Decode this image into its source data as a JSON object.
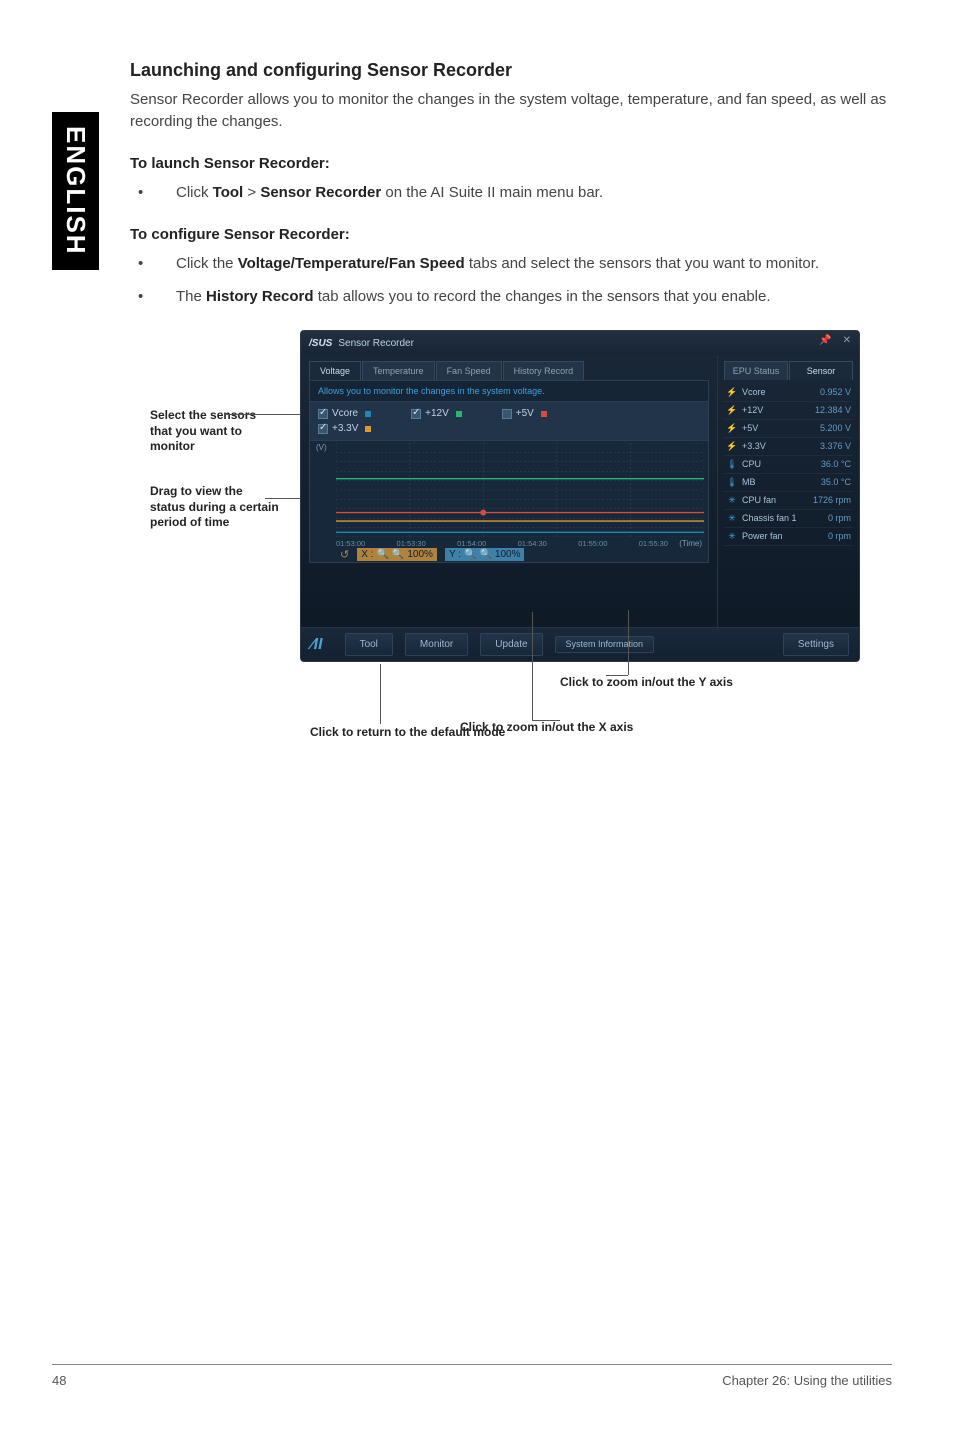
{
  "sidebar_label": "ENGLISH",
  "section_title": "Launching and configuring Sensor Recorder",
  "intro": "Sensor Recorder allows you to monitor the changes in the system voltage, temperature, and fan speed, as well as recording the changes.",
  "launch_head": "To launch Sensor Recorder:",
  "launch_item_pre": "Click ",
  "launch_tool": "Tool",
  "launch_gt": " > ",
  "launch_sr": "Sensor Recorder",
  "launch_item_post": " on the AI Suite II main menu bar.",
  "config_head": "To configure Sensor Recorder:",
  "config_item1_pre": "Click the ",
  "config_item1_bold": "Voltage/Temperature/Fan Speed",
  "config_item1_post": " tabs and select the sensors that you want to monitor.",
  "config_item2_pre": "The ",
  "config_item2_bold": "History Record",
  "config_item2_post": " tab allows you to record the changes in the sensors that you enable.",
  "annotations": {
    "select_sensors": "Select the sensors that you want to monitor",
    "drag_view": "Drag to view the status during a certain period of time",
    "zoom_y": "Click to zoom in/out the Y axis",
    "zoom_x": "Click to zoom in/out the X axis",
    "reset": "Click to return to the default mode"
  },
  "app": {
    "brand": "/SUS",
    "title": "Sensor Recorder",
    "win_pin": "📌",
    "win_close": "✕",
    "tabs": {
      "voltage": "Voltage",
      "temperature": "Temperature",
      "fan": "Fan Speed",
      "history": "History Record"
    },
    "desc": "Allows you to monitor the changes in the system voltage.",
    "checks": {
      "vcore": "Vcore",
      "p12v": "+12V",
      "p5v": "+5V",
      "p33v": "+3.3V"
    },
    "y_unit": "(V)",
    "time_label": "(Time)",
    "status_tabs": {
      "epu": "EPU Status",
      "sensor": "Sensor"
    },
    "sensors": [
      {
        "icon": "⚡",
        "name": "Vcore",
        "value": "0.952 V"
      },
      {
        "icon": "⚡",
        "name": "+12V",
        "value": "12.384 V"
      },
      {
        "icon": "⚡",
        "name": "+5V",
        "value": "5.200 V"
      },
      {
        "icon": "⚡",
        "name": "+3.3V",
        "value": "3.376 V"
      },
      {
        "icon": "🌡",
        "name": "CPU",
        "value": "36.0 °C"
      },
      {
        "icon": "🌡",
        "name": "MB",
        "value": "35.0 °C"
      },
      {
        "icon": "✳",
        "name": "CPU fan",
        "value": "1726 rpm"
      },
      {
        "icon": "✳",
        "name": "Chassis fan 1",
        "value": "0 rpm"
      },
      {
        "icon": "✳",
        "name": "Power fan",
        "value": "0 rpm"
      }
    ],
    "zoom": {
      "x_label": "X :",
      "y_label": "Y :",
      "x_pct": "100%",
      "y_pct": "100%"
    },
    "bottom": {
      "tool": "Tool",
      "monitor": "Monitor",
      "update": "Update",
      "sysinfo": "System Information",
      "settings": "Settings"
    }
  },
  "chart_data": {
    "type": "line",
    "xlabel": "(Time)",
    "ylabel": "(V)",
    "ylim": [
      0,
      20
    ],
    "y_ticks": [
      0,
      2,
      4,
      6,
      8,
      10,
      12,
      14,
      16,
      18,
      20
    ],
    "x_ticks": [
      "01:53:00",
      "01:53:30",
      "01:54:00",
      "01:54:30",
      "01:55:00",
      "01:55:30"
    ],
    "series": [
      {
        "name": "Vcore",
        "color": "#1f88b6",
        "values": [
          1.0,
          1.0,
          1.0,
          1.0,
          1.0,
          1.0
        ]
      },
      {
        "name": "+12V",
        "color": "#2bb673",
        "values": [
          12.4,
          12.4,
          12.4,
          12.4,
          12.4,
          12.4
        ]
      },
      {
        "name": "+5V",
        "color": "#d84a3e",
        "values": [
          5.2,
          5.2,
          5.2,
          5.2,
          5.2,
          5.2
        ]
      },
      {
        "name": "+3.3V",
        "color": "#e09a2b",
        "values": [
          3.4,
          3.4,
          3.4,
          3.4,
          3.4,
          3.4
        ]
      }
    ],
    "marker": {
      "x_index": 2,
      "series": "+5V",
      "color": "#d84a3e"
    }
  },
  "footer": {
    "page": "48",
    "chapter": "Chapter 26: Using the utilities"
  }
}
